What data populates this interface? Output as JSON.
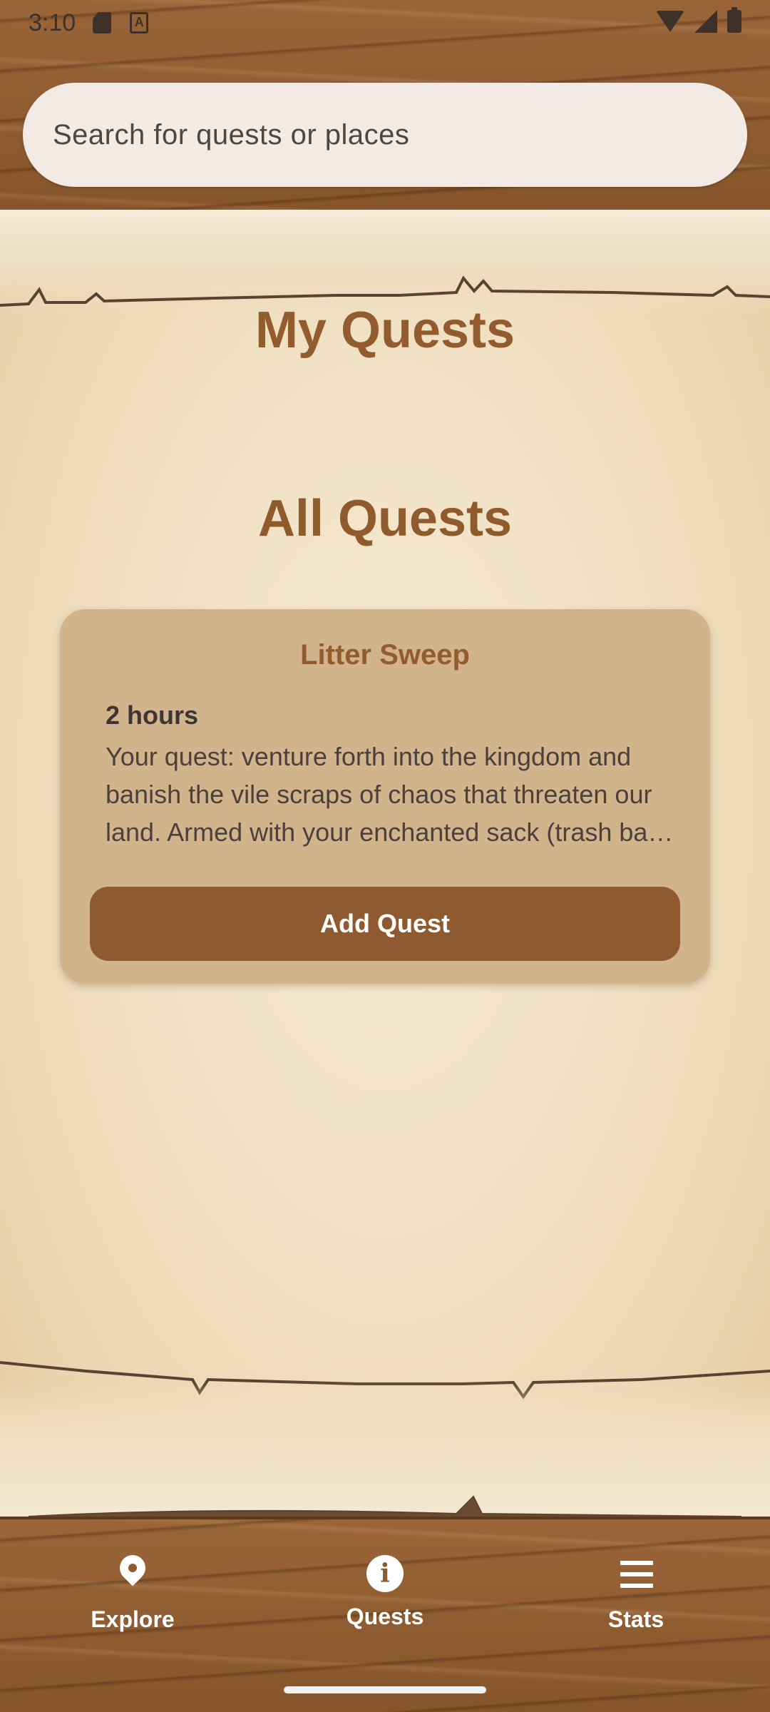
{
  "status_bar": {
    "time": "3:10",
    "sd_icon": "sd-card-icon",
    "a_icon": "a-box-icon",
    "wifi_icon": "wifi-icon",
    "signal_icon": "signal-icon",
    "battery_icon": "battery-icon"
  },
  "search": {
    "placeholder": "Search for quests or places"
  },
  "page": {
    "title": "My Quests",
    "section_title": "All Quests"
  },
  "quests": [
    {
      "title": "Litter Sweep",
      "duration": "2 hours",
      "description": "Your quest: venture forth into the kingdom and banish the vile scraps of chaos that threaten our land. Armed with your enchanted sack (trash bag) and gloves, you shall cleanse the realm.",
      "button_label": "Add Quest"
    }
  ],
  "bottom_nav": {
    "items": [
      {
        "label": "Explore",
        "icon": "location-pin-icon"
      },
      {
        "label": "Quests",
        "icon": "info-icon"
      },
      {
        "label": "Stats",
        "icon": "menu-icon"
      }
    ]
  },
  "colors": {
    "wood": "#8e5b31",
    "parchment": "#f1e1c4",
    "card": "#d2b48c",
    "accent_brown": "#935c2f",
    "button": "#8f5a2f"
  }
}
